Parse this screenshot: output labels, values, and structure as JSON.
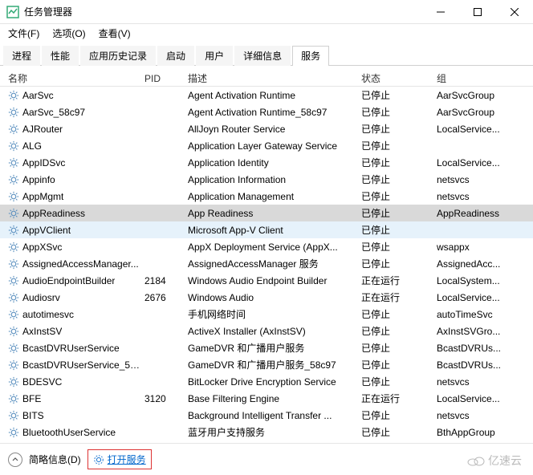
{
  "window": {
    "title": "任务管理器"
  },
  "menu": {
    "file": "文件(F)",
    "options": "选项(O)",
    "view": "查看(V)"
  },
  "tabs": [
    {
      "label": "进程"
    },
    {
      "label": "性能"
    },
    {
      "label": "应用历史记录"
    },
    {
      "label": "启动"
    },
    {
      "label": "用户"
    },
    {
      "label": "详细信息"
    },
    {
      "label": "服务",
      "active": true
    }
  ],
  "headers": {
    "name": "名称",
    "pid": "PID",
    "desc": "描述",
    "status": "状态",
    "group": "组"
  },
  "services": [
    {
      "name": "AarSvc",
      "pid": "",
      "desc": "Agent Activation Runtime",
      "status": "已停止",
      "group": "AarSvcGroup"
    },
    {
      "name": "AarSvc_58c97",
      "pid": "",
      "desc": "Agent Activation Runtime_58c97",
      "status": "已停止",
      "group": "AarSvcGroup"
    },
    {
      "name": "AJRouter",
      "pid": "",
      "desc": "AllJoyn Router Service",
      "status": "已停止",
      "group": "LocalService..."
    },
    {
      "name": "ALG",
      "pid": "",
      "desc": "Application Layer Gateway Service",
      "status": "已停止",
      "group": ""
    },
    {
      "name": "AppIDSvc",
      "pid": "",
      "desc": "Application Identity",
      "status": "已停止",
      "group": "LocalService..."
    },
    {
      "name": "Appinfo",
      "pid": "",
      "desc": "Application Information",
      "status": "已停止",
      "group": "netsvcs"
    },
    {
      "name": "AppMgmt",
      "pid": "",
      "desc": "Application Management",
      "status": "已停止",
      "group": "netsvcs"
    },
    {
      "name": "AppReadiness",
      "pid": "",
      "desc": "App Readiness",
      "status": "已停止",
      "group": "AppReadiness",
      "selected": true
    },
    {
      "name": "AppVClient",
      "pid": "",
      "desc": "Microsoft App-V Client",
      "status": "已停止",
      "group": "",
      "hover": true
    },
    {
      "name": "AppXSvc",
      "pid": "",
      "desc": "AppX Deployment Service (AppX...",
      "status": "已停止",
      "group": "wsappx"
    },
    {
      "name": "AssignedAccessManager...",
      "pid": "",
      "desc": "AssignedAccessManager 服务",
      "status": "已停止",
      "group": "AssignedAcc..."
    },
    {
      "name": "AudioEndpointBuilder",
      "pid": "2184",
      "desc": "Windows Audio Endpoint Builder",
      "status": "正在运行",
      "group": "LocalSystem..."
    },
    {
      "name": "Audiosrv",
      "pid": "2676",
      "desc": "Windows Audio",
      "status": "正在运行",
      "group": "LocalService..."
    },
    {
      "name": "autotimesvc",
      "pid": "",
      "desc": "手机网络时间",
      "status": "已停止",
      "group": "autoTimeSvc"
    },
    {
      "name": "AxInstSV",
      "pid": "",
      "desc": "ActiveX Installer (AxInstSV)",
      "status": "已停止",
      "group": "AxInstSVGro..."
    },
    {
      "name": "BcastDVRUserService",
      "pid": "",
      "desc": "GameDVR 和广播用户服务",
      "status": "已停止",
      "group": "BcastDVRUs..."
    },
    {
      "name": "BcastDVRUserService_58...",
      "pid": "",
      "desc": "GameDVR 和广播用户服务_58c97",
      "status": "已停止",
      "group": "BcastDVRUs..."
    },
    {
      "name": "BDESVC",
      "pid": "",
      "desc": "BitLocker Drive Encryption Service",
      "status": "已停止",
      "group": "netsvcs"
    },
    {
      "name": "BFE",
      "pid": "3120",
      "desc": "Base Filtering Engine",
      "status": "正在运行",
      "group": "LocalService..."
    },
    {
      "name": "BITS",
      "pid": "",
      "desc": "Background Intelligent Transfer ...",
      "status": "已停止",
      "group": "netsvcs"
    },
    {
      "name": "BluetoothUserService",
      "pid": "",
      "desc": "蓝牙用户支持服务",
      "status": "已停止",
      "group": "BthAppGroup"
    }
  ],
  "footer": {
    "fewer": "简略信息(D)",
    "openServices": "打开服务"
  },
  "watermark": "亿速云"
}
